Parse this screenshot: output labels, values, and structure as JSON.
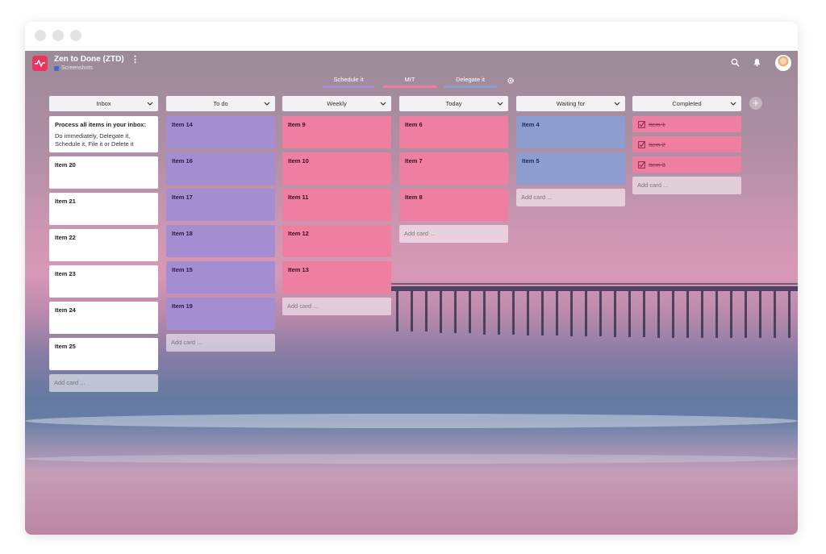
{
  "header": {
    "board_title": "Zen to Done (ZTD)",
    "kebab_symbol": "⋮",
    "workspace": "Screenshots"
  },
  "legend": [
    {
      "label": "Schedule it",
      "color": "#a48dd0"
    },
    {
      "label": "MIT",
      "color": "#ef7fa0"
    },
    {
      "label": "Delegate it",
      "color": "#8d9dd0"
    }
  ],
  "icons": {
    "logo": "pulse-logo-icon",
    "settings": "gear-icon",
    "search": "search-icon",
    "notifications": "bell-icon",
    "avatar": "user-avatar",
    "column_menu": "chevron-down-icon",
    "completed": "checkbox-checked-icon",
    "add_column": "plus-icon"
  },
  "add_column_symbol": "+",
  "add_card_label": "Add card ...",
  "columns": {
    "inbox": {
      "title": "Inbox",
      "info_title": "Process all items in your inbox:",
      "info_body": "Do immediately, Delegate it, Schedule it, File it or Delete it",
      "cards": [
        "Item 20",
        "Item 21",
        "Item 22",
        "Item 23",
        "Item 24",
        "Item 25"
      ]
    },
    "todo": {
      "title": "To do",
      "cards": [
        "Item 14",
        "Item 16",
        "Item 17",
        "Item 18",
        "Item 15",
        "Item 19"
      ]
    },
    "weekly": {
      "title": "Weekly",
      "cards": [
        "Item 9",
        "Item 10",
        "Item 11",
        "Item 12",
        "Item 13"
      ]
    },
    "today": {
      "title": "Today",
      "cards": [
        "Item 6",
        "Item 7",
        "Item 8"
      ]
    },
    "waiting": {
      "title": "Waiting for",
      "cards": [
        "Item 4",
        "Item 5"
      ]
    },
    "completed": {
      "title": "Completed",
      "cards": [
        "Item 1",
        "Item 2",
        "Item 3"
      ]
    }
  }
}
